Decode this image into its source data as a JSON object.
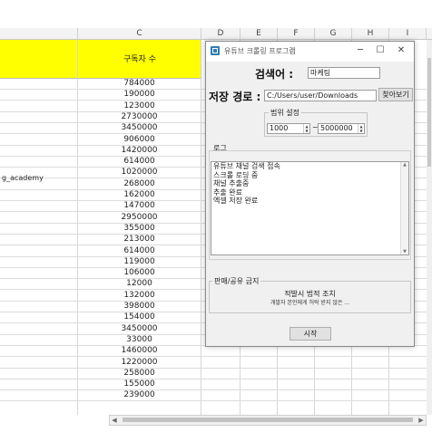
{
  "spreadsheet": {
    "columns": [
      "C",
      "D",
      "E",
      "F",
      "G",
      "H",
      "I"
    ],
    "header_c": "구독자 수",
    "partial_a_text": "g_academy",
    "subscribers": [
      "784000",
      "190000",
      "123000",
      "2730000",
      "3450000",
      "906000",
      "1420000",
      "614000",
      "1020000",
      "268000",
      "162000",
      "147000",
      "2950000",
      "355000",
      "213000",
      "614000",
      "119000",
      "106000",
      "12000",
      "132000",
      "398000",
      "154000",
      "3450000",
      "33000",
      "1460000",
      "1220000",
      "258000",
      "155000",
      "239000"
    ]
  },
  "dialog": {
    "title": "유튜브 크롤링 프로그램",
    "keyword_label": "검색어 :",
    "keyword_value": "마케팅",
    "path_label": "저장 경로 :",
    "path_value": "C:/Users/user/Downloads",
    "browse_button": "찾아보기",
    "range_title": "범위 설정",
    "range_from": "1000",
    "range_sep": "~",
    "range_to": "5000000",
    "log_title": "로그",
    "log_lines": [
      "유튜브 채널 검색 접속",
      "스크롤 로딩 중",
      "채널 추출중",
      "추출 완료",
      "엑셀 저장 완료"
    ],
    "notice_title": "판매/공유 금지",
    "notice_line1": "적발시 법적 조치",
    "notice_line2": "개발자 본인에게 허락 받지 않은 ...",
    "start_button": "시작"
  }
}
